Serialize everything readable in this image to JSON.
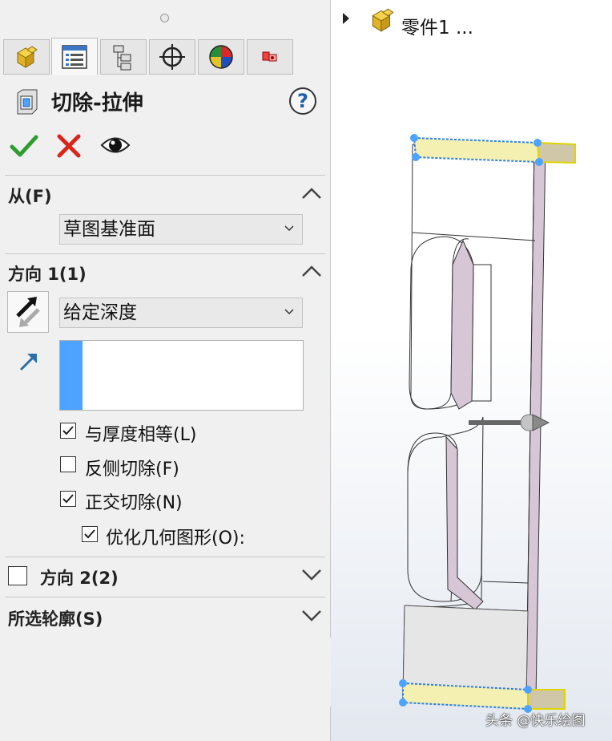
{
  "feature": {
    "title": "切除-拉伸",
    "help_icon": "question-icon"
  },
  "tabs": [
    {
      "name": "feature-manager",
      "icon": "part-cube-icon"
    },
    {
      "name": "property-manager",
      "icon": "property-list-icon"
    },
    {
      "name": "configuration-manager",
      "icon": "configuration-tree-icon"
    },
    {
      "name": "dimxpert-manager",
      "icon": "crosshair-icon"
    },
    {
      "name": "display-manager",
      "icon": "appearance-ball-icon"
    },
    {
      "name": "cam-manager",
      "icon": "cam-icon"
    }
  ],
  "from_section": {
    "title": "从(F)",
    "selected": "草图基准面"
  },
  "direction1": {
    "title": "方向 1(1)",
    "end_condition": "给定深度",
    "options": [
      {
        "label": "与厚度相等(L)",
        "checked": true
      },
      {
        "label": "反侧切除(F)",
        "checked": false
      },
      {
        "label": "正交切除(N)",
        "checked": true
      },
      {
        "label": "优化几何图形(O):",
        "checked": true
      }
    ]
  },
  "direction2": {
    "title": "方向 2(2)",
    "checked": false
  },
  "selected_contours": {
    "title": "所选轮廓(S)"
  },
  "tree": {
    "root_label": "零件1 ..."
  },
  "watermark": "头条 @快乐绘图",
  "colors": {
    "accept": "#2e9d2e",
    "cancel": "#d9261c",
    "accent": "#4da3ff",
    "highlight": "#f3f0b2"
  }
}
